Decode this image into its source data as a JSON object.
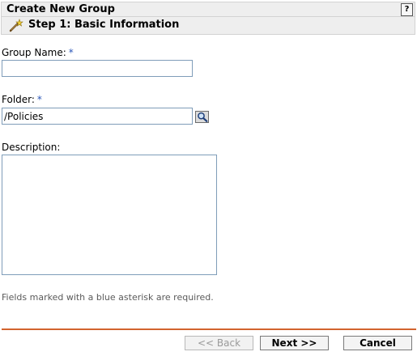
{
  "header": {
    "title": "Create New Group",
    "help_label": "?"
  },
  "step": {
    "label": "Step 1: Basic Information",
    "icon": "wand-icon"
  },
  "form": {
    "group_name": {
      "label": "Group Name:",
      "required_marker": "*",
      "value": ""
    },
    "folder": {
      "label": "Folder:",
      "required_marker": "*",
      "value": "/Policies",
      "browse_icon": "magnifier-icon"
    },
    "description": {
      "label": "Description:",
      "value": ""
    },
    "required_hint": "Fields marked with a blue asterisk are required."
  },
  "footer": {
    "back_label": "<< Back",
    "next_label": "Next >>",
    "cancel_label": "Cancel"
  },
  "colors": {
    "required_asterisk": "#2b57b8",
    "divider": "#d2632e",
    "header_background": "#eeeeee",
    "input_border": "#7f9db9"
  }
}
